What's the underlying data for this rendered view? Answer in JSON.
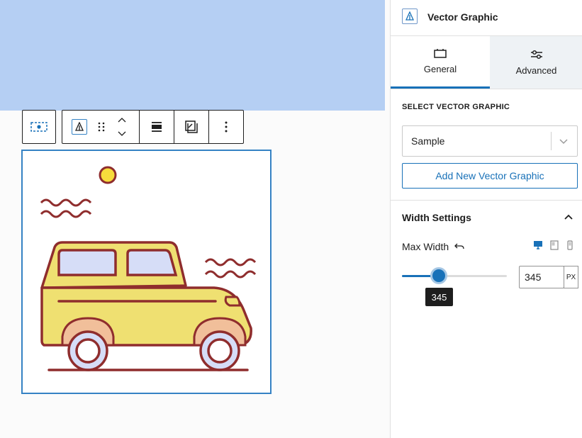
{
  "canvas": {
    "accent_color": "#b5cff3",
    "selection_color": "#3582c4"
  },
  "toolbar": {
    "buttons": [
      {
        "name": "block-placeholder-icon"
      },
      {
        "name": "vector-graphic-icon"
      },
      {
        "name": "drag-handle-icon"
      },
      {
        "name": "move-up-icon"
      },
      {
        "name": "move-down-icon"
      },
      {
        "name": "align-icon"
      },
      {
        "name": "replace-icon"
      },
      {
        "name": "more-options-icon"
      }
    ]
  },
  "image": {
    "subject": "yellow car illustration",
    "colors": {
      "body": "#efe071",
      "outline": "#8f2d2d",
      "windows": "#d6ddf7",
      "arches": "#f1bf9a",
      "sun": "#f7dc3c"
    }
  },
  "sidebar": {
    "block_title": "Vector Graphic",
    "tabs": [
      {
        "label": "General",
        "active": true
      },
      {
        "label": "Advanced",
        "active": false
      }
    ],
    "select_label": "SELECT VECTOR GRAPHIC",
    "select_value": "Sample",
    "add_button": "Add New Vector Graphic",
    "width_panel": {
      "title": "Width Settings",
      "max_width_label": "Max Width",
      "value": "345",
      "unit": "PX",
      "tooltip": "345",
      "slider_fraction": 0.35
    },
    "accent_color": "#1871b8"
  }
}
